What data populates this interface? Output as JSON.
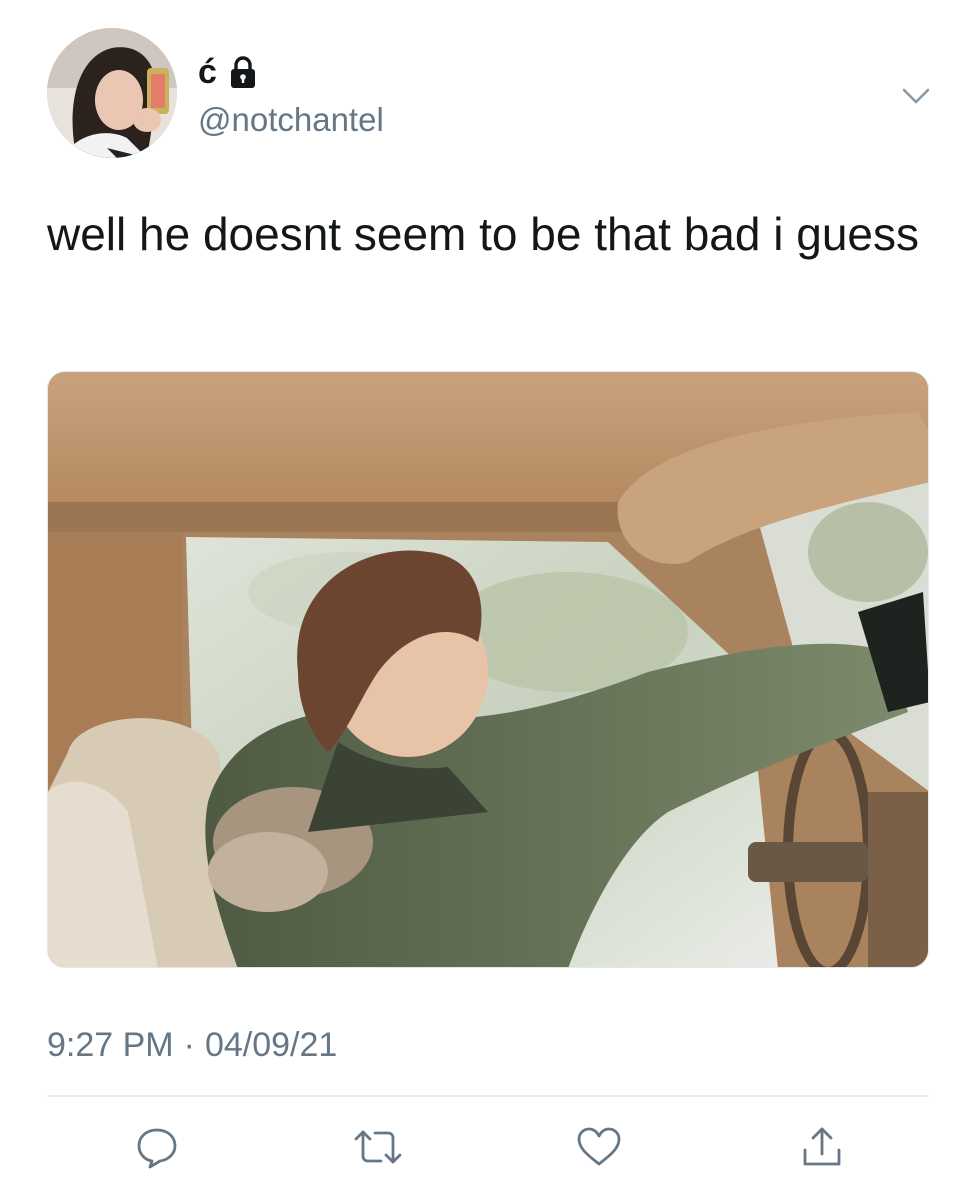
{
  "tweet": {
    "author": {
      "display_name": "ć",
      "handle": "@notchantel",
      "protected_icon": "lock-icon",
      "avatar_icon": "avatar-photo"
    },
    "menu_icon": "chevron-down-icon",
    "text": "well he doesnt seem to be that bad i guess",
    "media": {
      "type": "photo",
      "icon": "photo-image"
    },
    "time": "9:27 PM",
    "separator": "·",
    "date": "04/09/21",
    "actions": [
      {
        "name": "reply",
        "icon": "comment-icon"
      },
      {
        "name": "retweet",
        "icon": "retweet-icon"
      },
      {
        "name": "like",
        "icon": "heart-icon"
      },
      {
        "name": "share",
        "icon": "share-icon"
      }
    ]
  },
  "colors": {
    "text": "#14171a",
    "secondary": "#657786",
    "icon": "#657786",
    "divider": "#e6ecf0"
  }
}
